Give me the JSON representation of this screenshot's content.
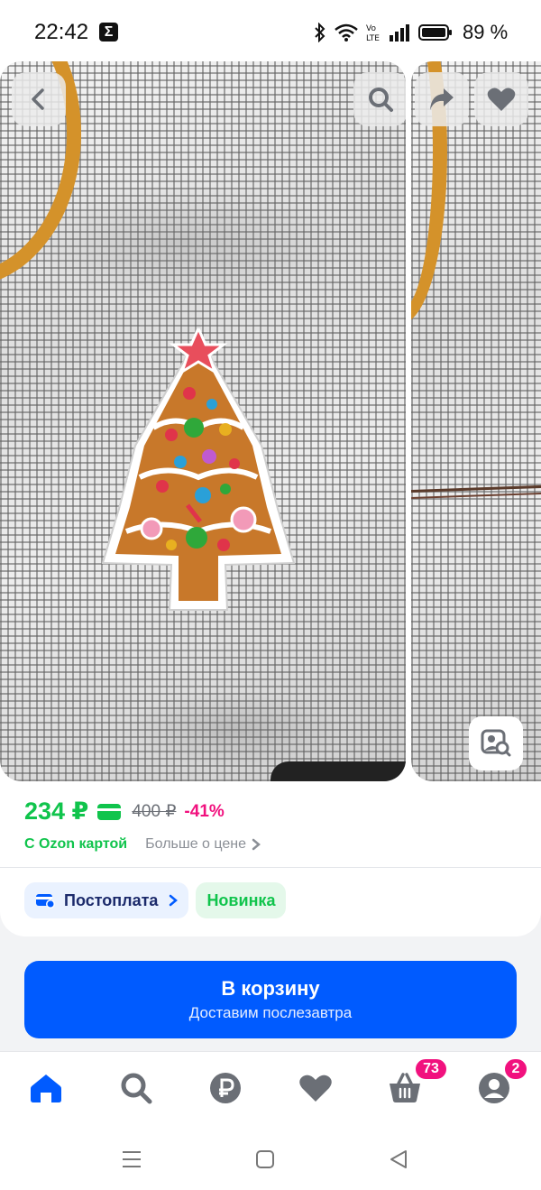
{
  "status_bar": {
    "time": "22:42",
    "notification_icon": "sigma-icon",
    "battery": "89 %",
    "icons": [
      "bluetooth-icon",
      "wifi-icon",
      "volte-icon",
      "signal-icon",
      "battery-icon"
    ]
  },
  "gallery": {
    "buttons": [
      "back-icon",
      "search-icon",
      "share-icon",
      "heart-icon",
      "lens-search-icon"
    ]
  },
  "price": {
    "current": "234 ₽",
    "old": "400 ₽",
    "discount": "-41%",
    "card_label": "С Ozon картой",
    "more_label": "Больше о цене"
  },
  "chips": {
    "postpay": "Постоплата",
    "new": "Новинка"
  },
  "cart_button": {
    "title": "В корзину",
    "subtitle": "Доставим послезавтра"
  },
  "bottom_nav": {
    "items": [
      "home-icon",
      "search-icon",
      "ruble-icon",
      "heart-icon",
      "cart-icon",
      "profile-icon"
    ],
    "cart_badge": "73",
    "profile_badge": "2"
  },
  "colors": {
    "accent_green": "#10c44c",
    "brand_blue": "#005bff",
    "badge_pink": "#f1117e"
  }
}
